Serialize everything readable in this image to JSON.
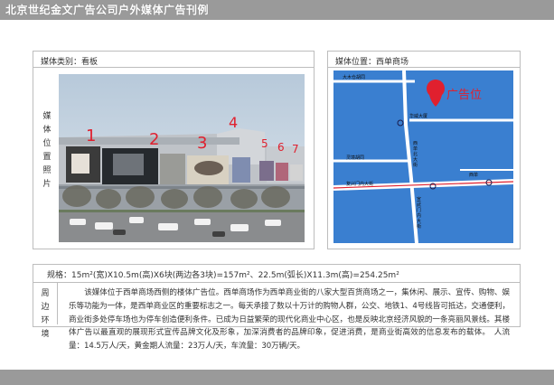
{
  "header": {
    "title": "北京世纪金文广告公司户外媒体广告刊例"
  },
  "media_panel": {
    "type_label": "媒体类别：看板",
    "photo_label_chars": [
      "媒",
      "体",
      "位",
      "置",
      "照",
      "片"
    ],
    "ad_numbers": [
      "1",
      "2",
      "3",
      "4",
      "5",
      "6",
      "7"
    ]
  },
  "map_panel": {
    "title": "媒体位置：西单商场",
    "pin_label": "广告位",
    "street_labels": {
      "top": "大木仓胡同",
      "building": "华威大厦",
      "mid_left": "灵境胡同",
      "xidan_north": "西单北大街",
      "main_avenue": "复兴门内大街",
      "south": "宣武门内大街",
      "right": "西单"
    }
  },
  "spec": {
    "text": "规格：15m²(宽)X10.5m(高)X6块(两边各3块)=157m²、22.5m(弧长)X11.3m(高)=254.25m²"
  },
  "description": {
    "label_chars": [
      "周",
      "边",
      "环",
      "境"
    ],
    "text": "该媒体位于西单商场西侧的楼体广告位。西单商场作为西单商业街的八家大型百货商场之一，集休闲、展示、宣传、购物、娱乐等功能为一体，是西单商业区的重要标志之一。每天承接了数以十万计的购物人群，公交、地铁1、4号线皆可抵达，交通便利，商业街多处停车场也为停车创造便利条件。已成为日益繁荣的现代化商业中心区，也是反映北京经济风貌的一条亮丽风景线。其楼体广告以最直观的展现形式宣传品牌文化及形象，加深消费者的品牌印象，促进消费，是商业街高效的信息发布的载体。　人流量：14.5万人/天，黄金期人流量：23万人/天，车流量：30万辆/天。"
  },
  "colors": {
    "header_gray": "#9a9a9a",
    "map_blue": "#3a7fd0",
    "pin_red": "#e0202e"
  }
}
